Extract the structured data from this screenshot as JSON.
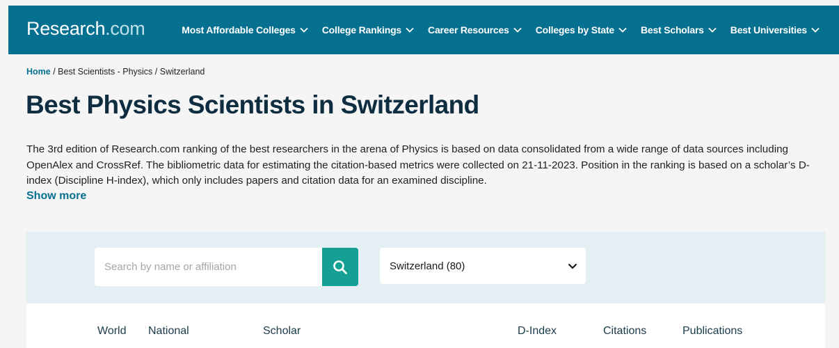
{
  "header": {
    "logo_main": "Research",
    "logo_suffix": ".com",
    "nav": [
      {
        "label": "Most Affordable Colleges"
      },
      {
        "label": "College Rankings"
      },
      {
        "label": "Career Resources"
      },
      {
        "label": "Colleges by State"
      },
      {
        "label": "Best Scholars"
      },
      {
        "label": "Best Universities"
      }
    ]
  },
  "breadcrumb": {
    "home": "Home",
    "sep1": " / ",
    "section": "Best Scientists - Physics ",
    "sep2": " / ",
    "current": "Switzerland"
  },
  "page": {
    "title": "Best Physics Scientists in Switzerland",
    "description": "The 3rd edition of Research.com ranking of the best researchers in the arena of Physics is based on data consolidated from a wide range of data sources including OpenAlex and CrossRef. The bibliometric data for estimating the citation-based metrics were collected on 21-11-2023. Position in the ranking is based on a scholar’s D-index (Discipline H-index), which only includes papers and citation data for an examined discipline.",
    "show_more": "Show more"
  },
  "filters": {
    "search_placeholder": "Search by name or affiliation",
    "search_value": "",
    "country_selected": "Switzerland (80)"
  },
  "table": {
    "headers": {
      "world": "World",
      "national": "National",
      "scholar": "Scholar",
      "dindex": "D-Index",
      "citations": "Citations",
      "publications": "Publications"
    }
  },
  "colors": {
    "nav_bg": "#05708f",
    "accent": "#05708f",
    "search_button": "#14a095",
    "title": "#0e2d40"
  },
  "icons": {
    "nav_dropdown": "chevron-down-icon",
    "search": "search-icon",
    "select_dropdown": "chevron-down-icon"
  }
}
